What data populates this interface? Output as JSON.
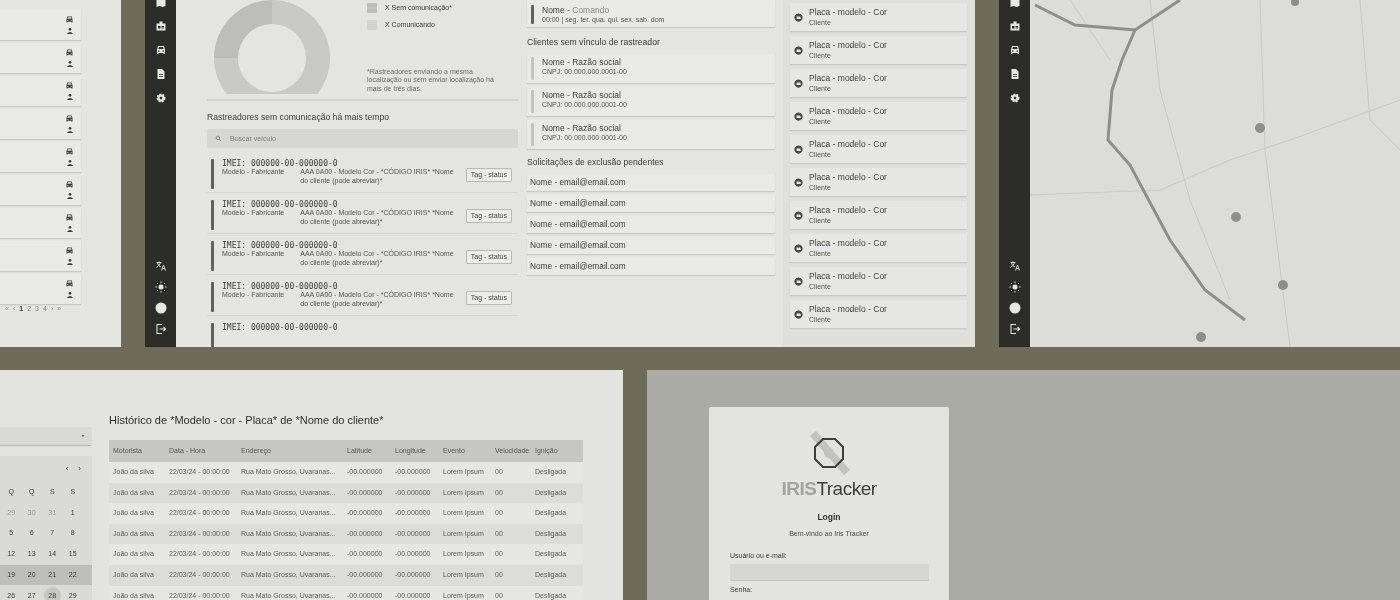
{
  "vehicle_list": {
    "pagination": [
      {
        "label": "«",
        "selected": false
      },
      {
        "label": "‹",
        "selected": false
      },
      {
        "label": "1",
        "selected": true
      },
      {
        "label": "2",
        "selected": false
      },
      {
        "label": "3",
        "selected": false
      },
      {
        "label": "4",
        "selected": false
      },
      {
        "label": "›",
        "selected": false
      },
      {
        "label": "»",
        "selected": false
      }
    ]
  },
  "dashboard": {
    "legend": [
      {
        "label": "X Sem comunicação*",
        "color": "#bdbeb9"
      },
      {
        "label": "X Comunicando",
        "color": "#d2d3ce"
      }
    ],
    "note": "*Rastreadores enviando a mesma localização ou sem enviar localização há mais de três dias.",
    "no_comm_heading": "Rastreadores sem comunicação há mais tempo",
    "search_placeholder": "Buscar veículo",
    "trackers": [
      {
        "imei": "IMEI: 000000-00-000000-0",
        "model": "Modelo - Fabricante",
        "details": "AAA 0A00 - Modelo Cor - *CÓDIGO IRIS* *Nome do cliente (pode abreviar)*",
        "tag": "Tag - status"
      },
      {
        "imei": "IMEI: 000000-00-000000-0",
        "model": "Modelo - Fabricante",
        "details": "AAA 0A00 - Modelo Cor - *CÓDIGO IRIS* *Nome do cliente (pode abreviar)*",
        "tag": "Tag - status"
      },
      {
        "imei": "IMEI: 000000-00-000000-0",
        "model": "Modelo - Fabricante",
        "details": "AAA 0A00 - Modelo Cor - *CÓDIGO IRIS* *Nome do cliente (pode abreviar)*",
        "tag": "Tag - status"
      },
      {
        "imei": "IMEI: 000000-00-000000-0",
        "model": "Modelo - Fabricante",
        "details": "AAA 0A00 - Modelo Cor - *CÓDIGO IRIS* *Nome do cliente (pode abreviar)*",
        "tag": "Tag - status"
      },
      {
        "imei": "IMEI: 000000-00-000000-0"
      }
    ],
    "schedule": {
      "name": "Nome -",
      "command": "Comando",
      "time": "00:00 | seg. ter. qua. qui. sex. sab. dom"
    },
    "clients_heading": "Clientes sem vínculo de rastreador",
    "clients": [
      {
        "name": "Nome - Razão social",
        "cnpj": "CNPJ: 00.000.000.0001-00"
      },
      {
        "name": "Nome - Razão social",
        "cnpj": "CNPJ: 00.000.000.0001-00"
      },
      {
        "name": "Nome - Razão social",
        "cnpj": "CNPJ: 00.000.000.0001-00"
      }
    ],
    "deletions_heading": "Solicitações de exclusão pendentes",
    "deletions": [
      "Nome - email@email.com",
      "Nome - email@email.com",
      "Nome - email@email.com",
      "Nome - email@email.com",
      "Nome - email@email.com"
    ],
    "vehicles": [
      {
        "plate": "Placa - modelo - Cor",
        "client": "Cliente"
      },
      {
        "plate": "Placa - modelo - Cor",
        "client": "Cliente"
      },
      {
        "plate": "Placa - modelo - Cor",
        "client": "Cliente"
      },
      {
        "plate": "Placa - modelo - Cor",
        "client": "Cliente"
      },
      {
        "plate": "Placa - modelo - Cor",
        "client": "Cliente"
      },
      {
        "plate": "Placa - modelo - Cor",
        "client": "Cliente"
      },
      {
        "plate": "Placa - modelo - Cor",
        "client": "Cliente"
      },
      {
        "plate": "Placa - modelo - Cor",
        "client": "Cliente"
      },
      {
        "plate": "Placa - modelo - Cor",
        "client": "Cliente"
      },
      {
        "plate": "Placa - modelo - Cor",
        "client": "Cliente"
      }
    ]
  },
  "history": {
    "calendar": {
      "nav": [
        "‹",
        "›"
      ],
      "weekdays": [
        "Q",
        "Q",
        "S",
        "S"
      ],
      "weeks": [
        {
          "selected": false,
          "days": [
            {
              "day": "29",
              "muted": true,
              "today": false
            },
            {
              "day": "30",
              "muted": true,
              "today": false
            },
            {
              "day": "31",
              "muted": true,
              "today": false
            },
            {
              "day": "1",
              "muted": false,
              "today": false
            }
          ]
        },
        {
          "selected": false,
          "days": [
            {
              "day": "5",
              "muted": false,
              "today": false
            },
            {
              "day": "6",
              "muted": false,
              "today": false
            },
            {
              "day": "7",
              "muted": false,
              "today": false
            },
            {
              "day": "8",
              "muted": false,
              "today": false
            }
          ]
        },
        {
          "selected": false,
          "days": [
            {
              "day": "12",
              "muted": false,
              "today": false
            },
            {
              "day": "13",
              "muted": false,
              "today": false
            },
            {
              "day": "14",
              "muted": false,
              "today": false
            },
            {
              "day": "15",
              "muted": false,
              "today": false
            }
          ]
        },
        {
          "selected": true,
          "days": [
            {
              "day": "19",
              "muted": false,
              "today": false
            },
            {
              "day": "20",
              "muted": false,
              "today": false
            },
            {
              "day": "21",
              "muted": false,
              "today": false
            },
            {
              "day": "22",
              "muted": false,
              "today": false
            }
          ]
        },
        {
          "selected": false,
          "days": [
            {
              "day": "26",
              "muted": false,
              "today": false
            },
            {
              "day": "27",
              "muted": false,
              "today": false
            },
            {
              "day": "28",
              "muted": false,
              "today": true
            },
            {
              "day": "29",
              "muted": false,
              "today": false
            }
          ]
        }
      ]
    },
    "title": "Histórico de *Modelo - cor - Placa* de *Nome do cliente*",
    "table": {
      "columns": [
        "Motorista",
        "Data - Hora",
        "Endereço",
        "Latitude",
        "Longitude",
        "Evento",
        "Velocidade",
        "Ignição"
      ],
      "rows": [
        [
          "João da silva",
          "22/03/24 - 00:00:00",
          "Rua Mato Grosso, Uvaranas...",
          "-00.000000",
          "-00.000000",
          "Lorem Ipsum",
          "00",
          "Desligada"
        ],
        [
          "João da silva",
          "22/03/24 - 00:00:00",
          "Rua Mato Grosso, Uvaranas...",
          "-00.000000",
          "-00.000000",
          "Lorem Ipsum",
          "00",
          "Desligada"
        ],
        [
          "João da silva",
          "22/03/24 - 00:00:00",
          "Rua Mato Grosso, Uvaranas...",
          "-00.000000",
          "-00.000000",
          "Lorem Ipsum",
          "00",
          "Desligada"
        ],
        [
          "João da silva",
          "22/03/24 - 00:00:00",
          "Rua Mato Grosso, Uvaranas...",
          "-00.000000",
          "-00.000000",
          "Lorem Ipsum",
          "00",
          "Desligada"
        ],
        [
          "João da silva",
          "22/03/24 - 00:00:00",
          "Rua Mato Grosso, Uvaranas...",
          "-00.000000",
          "-00.000000",
          "Lorem Ipsum",
          "00",
          "Desligada"
        ],
        [
          "João da silva",
          "22/03/24 - 00:00:00",
          "Rua Mato Grosso, Uvaranas...",
          "-00.000000",
          "-00.000000",
          "Lorem Ipsum",
          "00",
          "Desligada"
        ],
        [
          "João da silva",
          "22/03/24 - 00:00:00",
          "Rua Mato Grosso, Uvaranas...",
          "-00.000000",
          "-00.000000",
          "Lorem Ipsum",
          "00",
          "Desligada"
        ]
      ]
    }
  },
  "login": {
    "wordmark": [
      {
        "text": "IRIS",
        "faded": true
      },
      {
        "text": "Tracker",
        "faded": false
      }
    ],
    "title": "Login",
    "subtitle": "Bem-vindo ao Iris Tracker",
    "user_label": "Usuário ou e-mail:",
    "password_label": "Senha:"
  }
}
